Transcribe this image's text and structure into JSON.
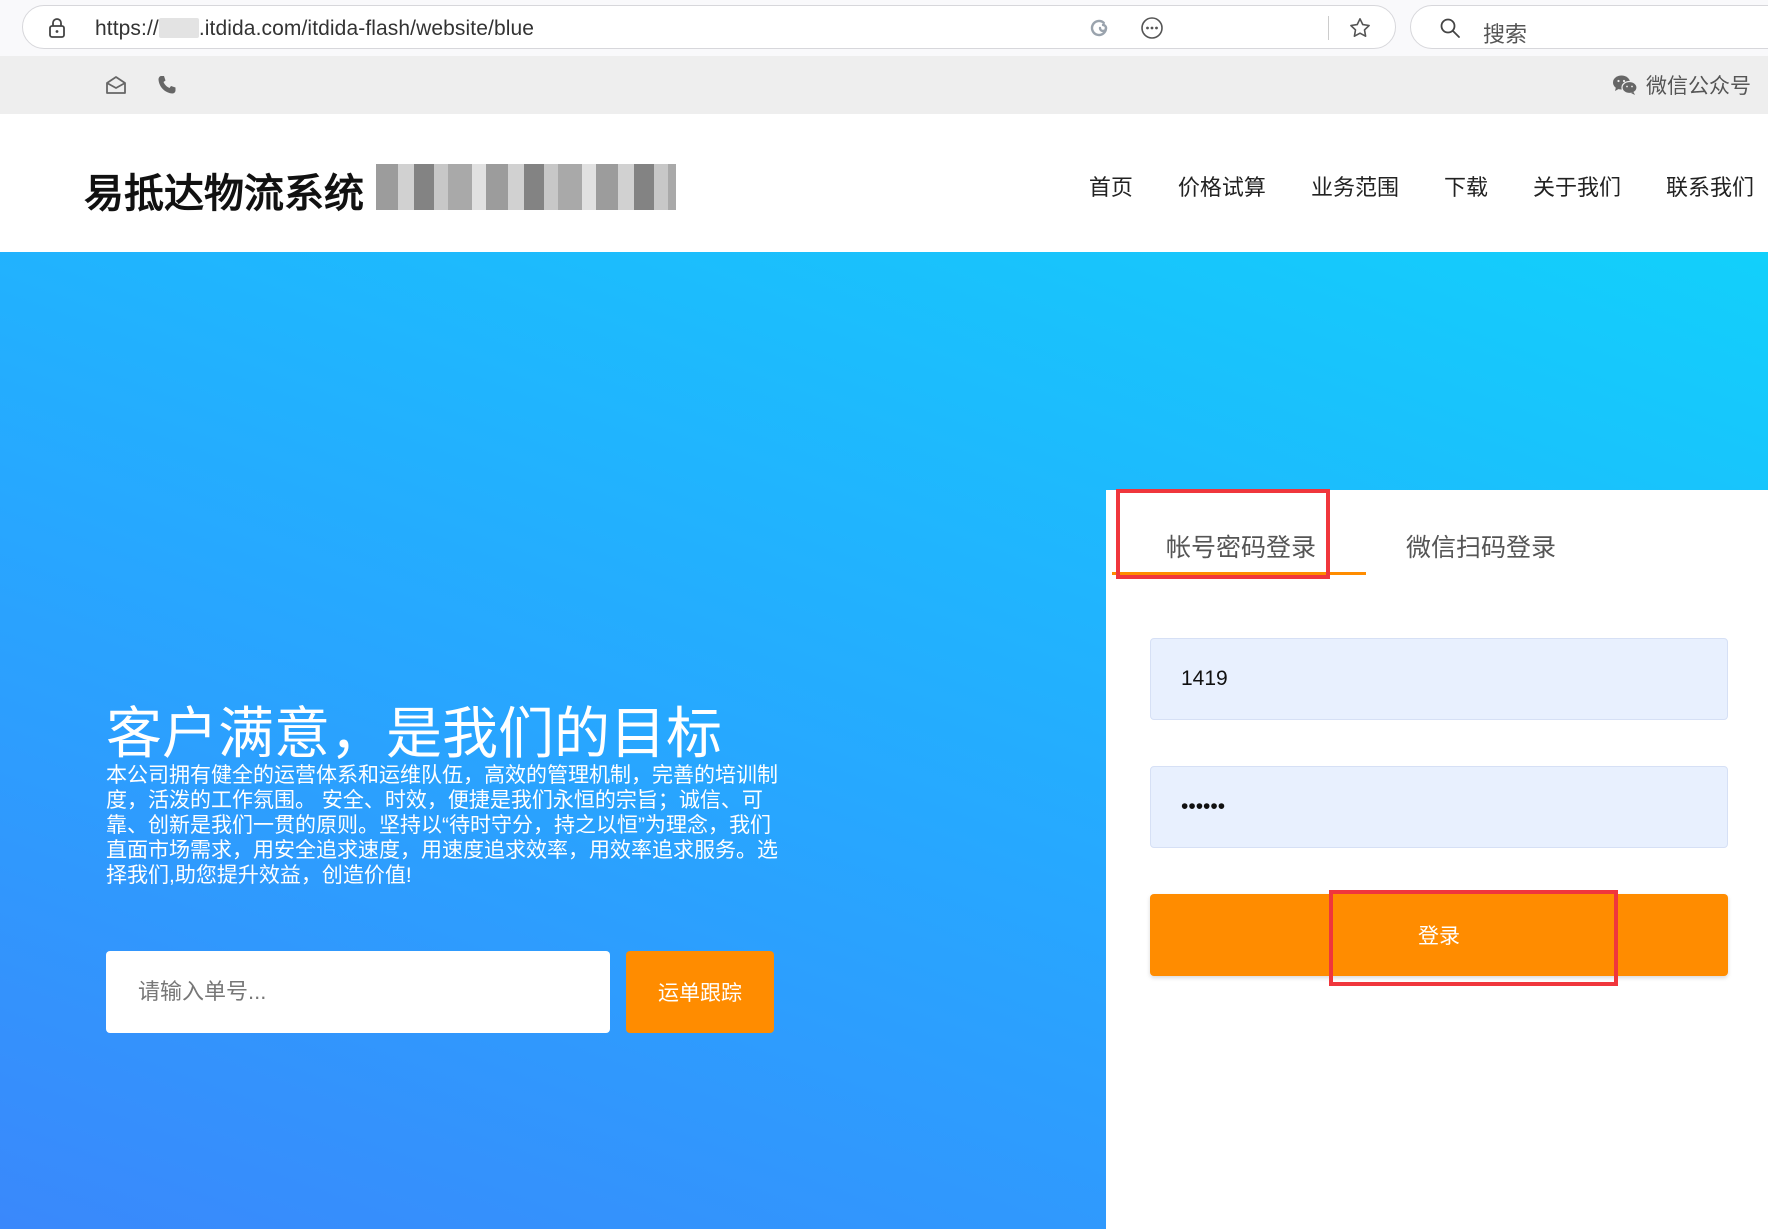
{
  "browser": {
    "url_prefix": "https://",
    "url_suffix": ".itdida.com/itdida-flash/website/blue",
    "search_placeholder": "搜索",
    "icons": [
      "lock-icon",
      "refresh-icon",
      "more-icon",
      "star-icon",
      "search-icon"
    ]
  },
  "topbar": {
    "wechat_label": "微信公众号",
    "icons": [
      "email-icon",
      "phone-icon",
      "wechat-icon"
    ]
  },
  "header": {
    "logo": "易抵达物流系统",
    "nav": [
      "首页",
      "价格试算",
      "业务范围",
      "下载",
      "关于我们",
      "联系我们"
    ]
  },
  "hero": {
    "title": "客户满意，是我们的目标",
    "description": "本公司拥有健全的运营体系和运维队伍，高效的管理机制，完善的培训制度，活泼的工作氛围。 安全、时效，便捷是我们永恒的宗旨；诚信、可靠、创新是我们一贯的原则。坚持以“待时守分，持之以恒”为理念，我们直面市场需求，用安全追求速度，用速度追求效率，用效率追求服务。选择我们,助您提升效益，创造价值!",
    "track_placeholder": "请输入单号...",
    "track_button": "运单跟踪"
  },
  "login": {
    "tabs": [
      "帐号密码登录",
      "微信扫码登录"
    ],
    "active_tab": 0,
    "username_value": "1419",
    "password_value": "••••••",
    "submit_label": "登录"
  },
  "colors": {
    "accent": "#ff8c00",
    "hero_start": "#3a88fb",
    "hero_end": "#12d0fb",
    "highlight": "#f0363c",
    "field_bg": "#e8f0fe"
  }
}
